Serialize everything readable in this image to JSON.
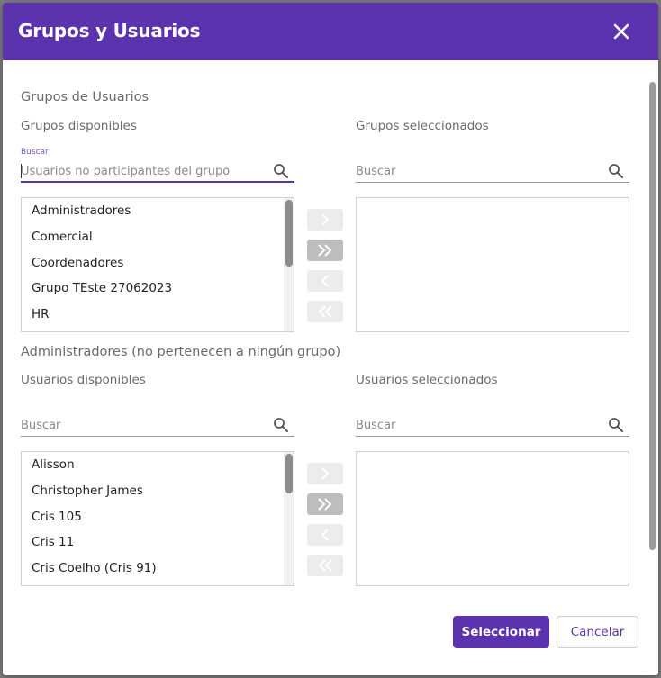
{
  "dialog": {
    "title": "Grupos y Usuarios"
  },
  "groups_section": {
    "title": "Grupos de Usuarios",
    "available_label": "Grupos disponibles",
    "selected_label": "Grupos seleccionados",
    "left_search": {
      "float_label": "Buscar",
      "placeholder": "Usuarios no participantes del grupo"
    },
    "right_search": {
      "placeholder": "Buscar"
    },
    "available_items": [
      "Administradores",
      "Comercial",
      "Coordenadores",
      "Grupo TEste 27062023",
      "HR"
    ],
    "selected_items": []
  },
  "users_section": {
    "title": "Administradores (no pertenecen a ningún grupo)",
    "available_label": "Usuarios disponibles",
    "selected_label": "Usuarios seleccionados",
    "left_search": {
      "placeholder": "Buscar"
    },
    "right_search": {
      "placeholder": "Buscar"
    },
    "available_items": [
      "Alisson",
      "Christopher James",
      "Cris 105",
      "Cris 11",
      "Cris Coelho (Cris 91)"
    ],
    "selected_items": []
  },
  "transfer_buttons": {
    "move_one_right": "chevron-right-icon",
    "move_all_right": "double-chevron-right-icon",
    "move_one_left": "chevron-left-icon",
    "move_all_left": "double-chevron-left-icon"
  },
  "footer": {
    "primary_label": "Seleccionar",
    "secondary_label": "Cancelar"
  },
  "colors": {
    "accent": "#5c33ae",
    "header_bg": "#5c33ae"
  }
}
